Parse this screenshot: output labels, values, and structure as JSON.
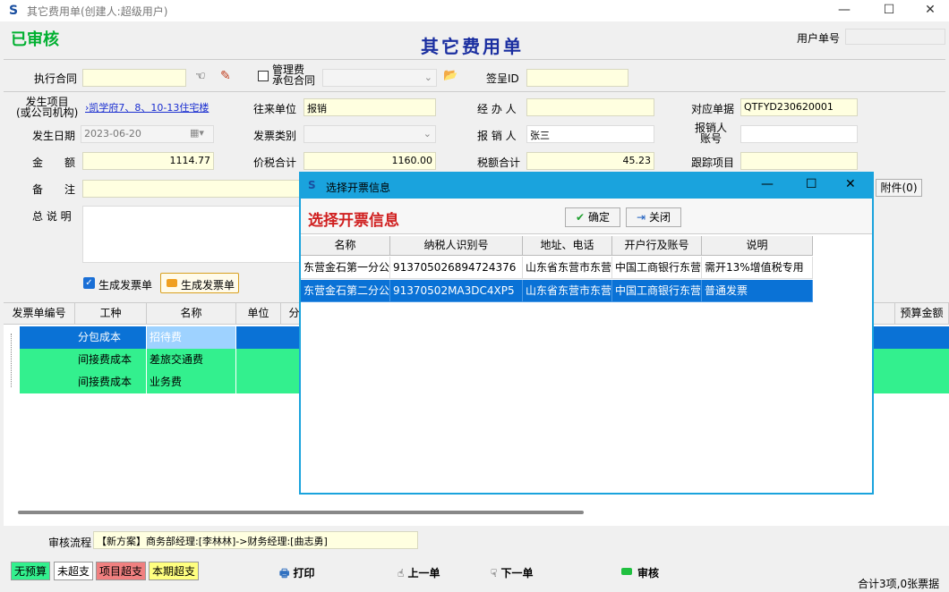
{
  "window": {
    "title": "其它费用单(创建人:超级用户)",
    "min": "—",
    "max": "☐",
    "close": "✕"
  },
  "status_stamp": "已审核",
  "form_title": "其它费用单",
  "user_no_label": "用户单号",
  "row1": {
    "contract_label": "执行合同",
    "mgmt_label_1": "管理费",
    "mgmt_label_2": "承包合同",
    "sign_label": "签呈ID"
  },
  "row2": {
    "item_label_1": "发生项目",
    "item_label_2": "(或公司机构)",
    "item_value": "›凯学府7、8、10-13住宅楼",
    "partner_label": "往来单位",
    "partner_value": "报销",
    "handler_label": "经 办 人",
    "ref_label": "对应单据",
    "ref_value": "QTFYD230620001"
  },
  "row3": {
    "date_label": "发生日期",
    "date_value": "2023-06-20",
    "invoice_type_label": "发票类别",
    "reimburser_label": "报 销 人",
    "reimburser_value": "张三",
    "acct_label_1": "报销人",
    "acct_label_2": "账号"
  },
  "row4": {
    "amount_label": "金　　额",
    "amount_value": "1114.77",
    "total_label": "价税合计",
    "total_value": "1160.00",
    "tax_label": "税额合计",
    "tax_value": "45.23",
    "track_label": "跟踪项目"
  },
  "row5": {
    "remark_label": "备　　注",
    "attach_label": "附件(0)"
  },
  "summary_label": "总 说 明",
  "gen": {
    "checkbox_label": "生成发票单",
    "button_label": "生成发票单"
  },
  "grid": {
    "headers": [
      "发票单编号",
      "工种",
      "名称",
      "单位",
      "分",
      "预算金额"
    ],
    "rows": [
      [
        "",
        "分包成本",
        "招待费"
      ],
      [
        "",
        "间接费成本",
        "差旅交通费"
      ],
      [
        "",
        "间接费成本",
        "业务费"
      ]
    ]
  },
  "flow": {
    "label": "审核流程",
    "value": "【新方案】商务部经理:[李林林]->财务经理:[曲志勇]"
  },
  "legend": [
    "无预算",
    "未超支",
    "项目超支",
    "本期超支"
  ],
  "actions": {
    "print": "打印",
    "prev": "上一单",
    "next": "下一单",
    "approve": "审核"
  },
  "count_text": "合计3项,0张票据",
  "dialog": {
    "title": "选择开票信息",
    "heading": "选择开票信息",
    "ok": "确定",
    "close_btn": "关闭",
    "headers": [
      "名称",
      "纳税人识别号",
      "地址、电话",
      "开户行及账号",
      "说明"
    ],
    "rows": [
      [
        "东营金石第一分公",
        "913705026894724376",
        "山东省东营市东营",
        "中国工商银行东营",
        "需开13%增值税专用"
      ],
      [
        "东营金石第二分公",
        "91370502MA3DC4XP5",
        "山东省东营市东营",
        "中国工商银行东营",
        "普通发票"
      ]
    ]
  },
  "colors": {
    "selected": "#0a72d6",
    "green_row": "#33f08e",
    "yellow_field": "#ffffe0",
    "accent": "#1aa3dd"
  }
}
